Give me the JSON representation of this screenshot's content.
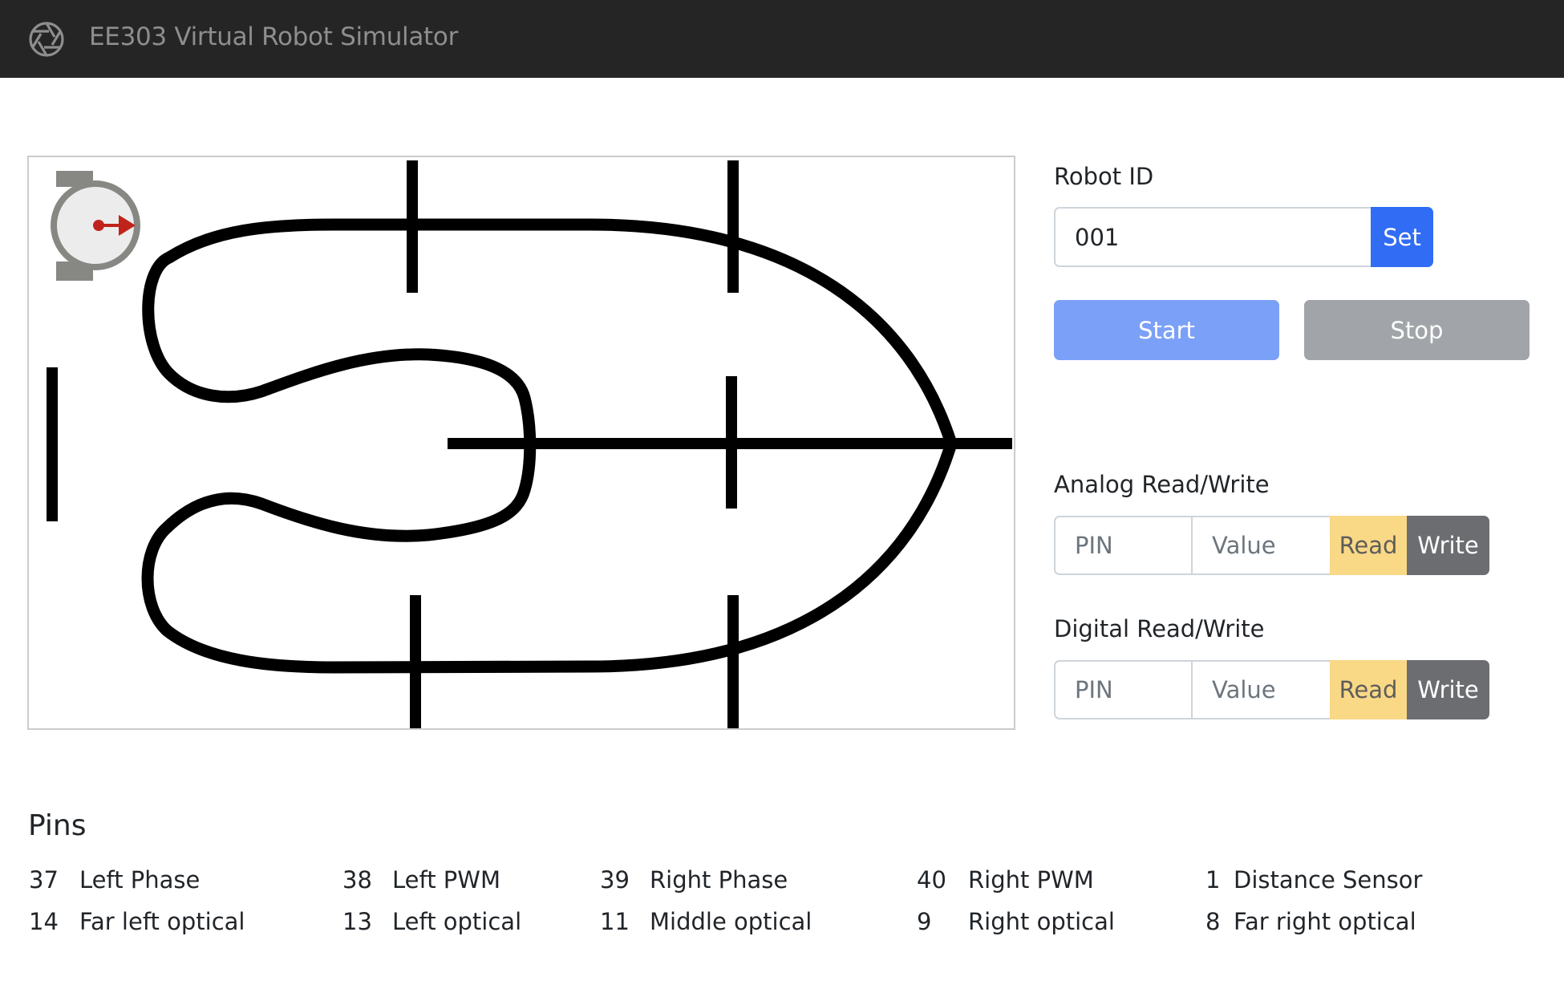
{
  "app": {
    "title": "EE303 Virtual Robot Simulator",
    "logo_icon": "aperture-icon"
  },
  "robot_id": {
    "label": "Robot ID",
    "value": "001",
    "set_label": "Set"
  },
  "controls": {
    "start_label": "Start",
    "stop_label": "Stop"
  },
  "analog": {
    "label": "Analog Read/Write",
    "pin_placeholder": "PIN",
    "value_placeholder": "Value",
    "read_label": "Read",
    "write_label": "Write"
  },
  "digital": {
    "label": "Digital Read/Write",
    "pin_placeholder": "PIN",
    "value_placeholder": "Value",
    "read_label": "Read",
    "write_label": "Write"
  },
  "pins": {
    "title": "Pins",
    "rows": [
      [
        {
          "num": "37",
          "name": "Left Phase"
        },
        {
          "num": "38",
          "name": "Left PWM"
        },
        {
          "num": "39",
          "name": "Right Phase"
        },
        {
          "num": "40",
          "name": "Right PWM"
        },
        {
          "num": "1",
          "name": "Distance Sensor"
        }
      ],
      [
        {
          "num": "14",
          "name": "Far left optical"
        },
        {
          "num": "13",
          "name": "Left optical"
        },
        {
          "num": "11",
          "name": "Middle optical"
        },
        {
          "num": "9",
          "name": "Right optical"
        },
        {
          "num": "8",
          "name": "Far right optical"
        }
      ]
    ]
  },
  "colors": {
    "navbar": "#252525",
    "primary": "#316cf4",
    "primary_disabled": "#7ba0f7",
    "secondary_disabled": "#a1a5a9",
    "warning_disabled": "#f9d886",
    "secondary": "#6c6d70",
    "track": "#000000",
    "robot_body": "#878884",
    "robot_face": "#ececec",
    "robot_heading": "#c0231c"
  }
}
